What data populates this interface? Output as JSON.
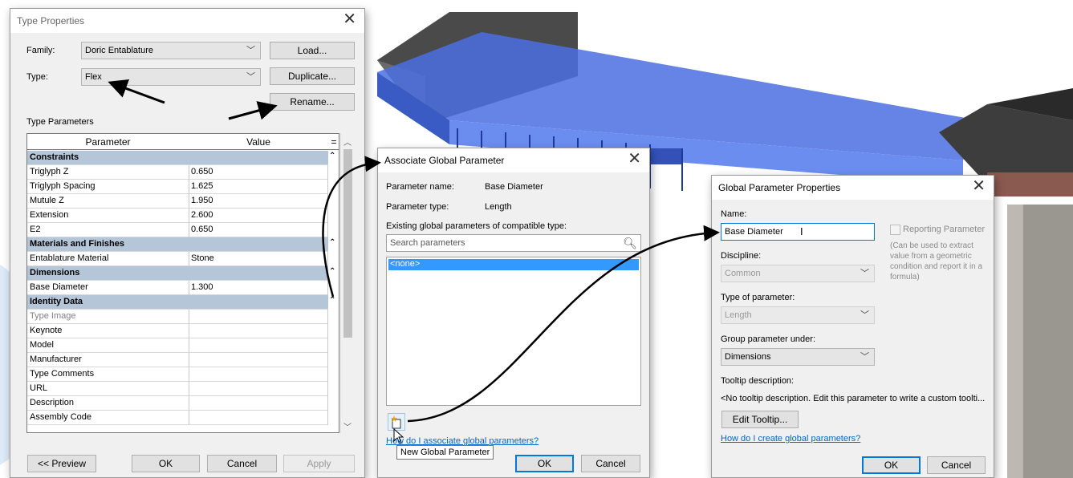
{
  "type_properties": {
    "title": "Type Properties",
    "family_label": "Family:",
    "family_value": "Doric Entablature",
    "type_label": "Type:",
    "type_value": "Flex",
    "load_button": "Load...",
    "duplicate_button": "Duplicate...",
    "rename_button": "Rename...",
    "section_label": "Type Parameters",
    "col_parameter": "Parameter",
    "col_value": "Value",
    "col_eq": "=",
    "groups": [
      {
        "name": "Constraints",
        "rows": [
          {
            "k": "Triglyph Z",
            "v": "0.650"
          },
          {
            "k": "Triglyph Spacing",
            "v": "1.625"
          },
          {
            "k": "Mutule Z",
            "v": "1.950"
          },
          {
            "k": "Extension",
            "v": "2.600"
          },
          {
            "k": "E2",
            "v": "0.650"
          }
        ]
      },
      {
        "name": "Materials and Finishes",
        "rows": [
          {
            "k": "Entablature Material",
            "v": "Stone"
          }
        ]
      },
      {
        "name": "Dimensions",
        "rows": [
          {
            "k": "Base Diameter",
            "v": "1.300"
          }
        ]
      },
      {
        "name": "Identity Data",
        "rows": [
          {
            "k": "Type Image",
            "v": ""
          },
          {
            "k": "Keynote",
            "v": ""
          },
          {
            "k": "Model",
            "v": ""
          },
          {
            "k": "Manufacturer",
            "v": ""
          },
          {
            "k": "Type Comments",
            "v": ""
          },
          {
            "k": "URL",
            "v": ""
          },
          {
            "k": "Description",
            "v": ""
          },
          {
            "k": "Assembly Code",
            "v": ""
          }
        ]
      }
    ],
    "preview_button": "<< Preview",
    "ok_button": "OK",
    "cancel_button": "Cancel",
    "apply_button": "Apply"
  },
  "associate": {
    "title": "Associate Global Parameter",
    "name_label": "Parameter name:",
    "name_value": "Base Diameter",
    "type_label": "Parameter type:",
    "type_value": "Length",
    "existing_label": "Existing global parameters of compatible type:",
    "search_placeholder": "Search parameters",
    "list_items": [
      "<none>"
    ],
    "help_link": "How do I associate global parameters?",
    "tooltip": "New Global Parameter",
    "ok_button": "OK",
    "cancel_button": "Cancel"
  },
  "global_props": {
    "title": "Global Parameter Properties",
    "name_label": "Name:",
    "name_value": "Base Diameter",
    "reporting_label": "Reporting Parameter",
    "reporting_note": "(Can be used to extract value from a geometric condition and report it in a formula)",
    "discipline_label": "Discipline:",
    "discipline_value": "Common",
    "type_label": "Type of parameter:",
    "type_value": "Length",
    "group_label": "Group parameter under:",
    "group_value": "Dimensions",
    "tooltip_label": "Tooltip description:",
    "tooltip_value": "<No tooltip description. Edit this parameter to write a custom toolti...",
    "edit_tooltip_button": "Edit Tooltip...",
    "help_link": "How do I create global parameters?",
    "ok_button": "OK",
    "cancel_button": "Cancel"
  },
  "colors": {
    "selection": "#3399ff",
    "group_header": "#b5c6d9",
    "link": "#0066cc",
    "model_blue": "#5a7de6"
  }
}
